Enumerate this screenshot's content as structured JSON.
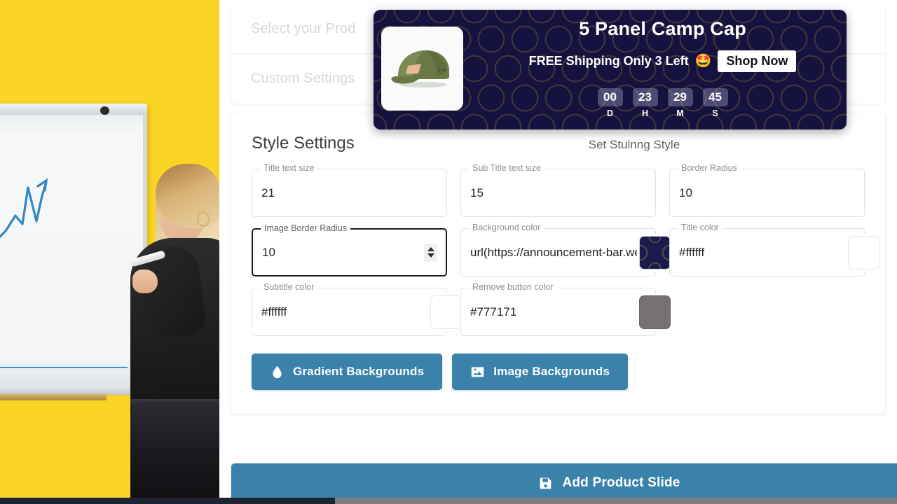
{
  "photo": {
    "alt_description": "woman-at-whiteboard-growth-chart",
    "background_color": "#FBD523",
    "chart_line_color": "#2f86c8"
  },
  "app": {
    "accordion": {
      "items": [
        {
          "label": "Select your Prod",
          "name": "select-your-product"
        },
        {
          "label": "Custom Settings",
          "name": "custom-settings"
        }
      ]
    },
    "settings_card": {
      "title": "Style Settings",
      "subtitle": "Set Stuinng Style",
      "fields": [
        {
          "label": "Title text size",
          "value": "21",
          "type": "number",
          "swatch": null,
          "focused": false
        },
        {
          "label": "Sub Title text size",
          "value": "15",
          "type": "number",
          "swatch": null,
          "focused": false
        },
        {
          "label": "Border Radius",
          "value": "10",
          "type": "number",
          "swatch": null,
          "focused": false
        },
        {
          "label": "Image Border Radius",
          "value": "10",
          "type": "number",
          "swatch": null,
          "focused": true
        },
        {
          "label": "Background color",
          "value": "url(https://announcement-bar.we",
          "type": "color",
          "swatch": "pattern",
          "focused": false
        },
        {
          "label": "Title color",
          "value": "#ffffff",
          "type": "color",
          "swatch": "#ffffff",
          "focused": false
        },
        {
          "label": "Subtitle color",
          "value": "#ffffff",
          "type": "color",
          "swatch": "#ffffff",
          "focused": false
        },
        {
          "label": "Remove button color",
          "value": "#777171",
          "type": "color",
          "swatch": "#777171",
          "focused": false
        }
      ],
      "buttons": [
        {
          "label": "Gradient Backgrounds",
          "icon": "water-drop-icon"
        },
        {
          "label": "Image Backgrounds",
          "icon": "image-icon"
        }
      ]
    },
    "add_product_slide": {
      "label": "Add Product Slide",
      "icon": "save-floppy-icon"
    },
    "accent_color": "#3b82ab"
  },
  "announcement_bar": {
    "title": "5 Panel Camp Cap",
    "subtitle": "FREE Shipping Only 3 Left",
    "emoji": "🤩",
    "cta_label": "Shop Now",
    "background_color": "#16123f",
    "pattern_color": "#968634",
    "title_color": "#ffffff",
    "subtitle_color": "#ffffff",
    "product_image_alt": "olive-green-5-panel-camp-cap",
    "countdown": [
      {
        "value": "00",
        "unit": "D"
      },
      {
        "value": "23",
        "unit": "H"
      },
      {
        "value": "29",
        "unit": "M"
      },
      {
        "value": "45",
        "unit": "S"
      }
    ]
  }
}
